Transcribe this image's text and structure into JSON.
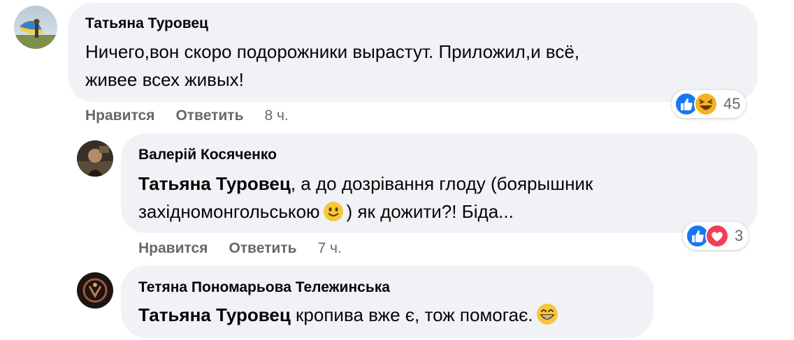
{
  "comments": [
    {
      "author": "Татьяна Туровец",
      "lines": [
        "Ничего,вон скоро подорожники вырастут. Приложил,и всё,",
        "живее всех живых!"
      ],
      "actions": {
        "like": "Нравится",
        "reply": "Ответить",
        "time": "8 ч."
      },
      "reactions": {
        "icons": [
          "like-icon",
          "haha-icon"
        ],
        "count": "45"
      }
    },
    {
      "author": "Валерій Косяченко",
      "mention": "Татьяна Туровец",
      "line1_rest": ", а до дозрівання глоду (боярышник",
      "line2_before": "західномонгольською",
      "line2_after": ") як дожити?! Біда...",
      "emoji": "slightly-smiling-face-icon",
      "actions": {
        "like": "Нравится",
        "reply": "Ответить",
        "time": "7 ч."
      },
      "reactions": {
        "icons": [
          "like-icon",
          "love-icon"
        ],
        "count": "3"
      }
    },
    {
      "author": "Тетяна Пономарьова Тележинська",
      "mention": "Татьяна Туровец",
      "rest": " кропива вже є, тож помогає.",
      "emoji": "grinning-face-icon"
    }
  ],
  "colors": {
    "bubble": "#f0f2f5",
    "secondary_text": "#65676b",
    "like_blue": "#1877f2",
    "love_red": "#f33e58",
    "haha_yellow": "#f7b125"
  }
}
